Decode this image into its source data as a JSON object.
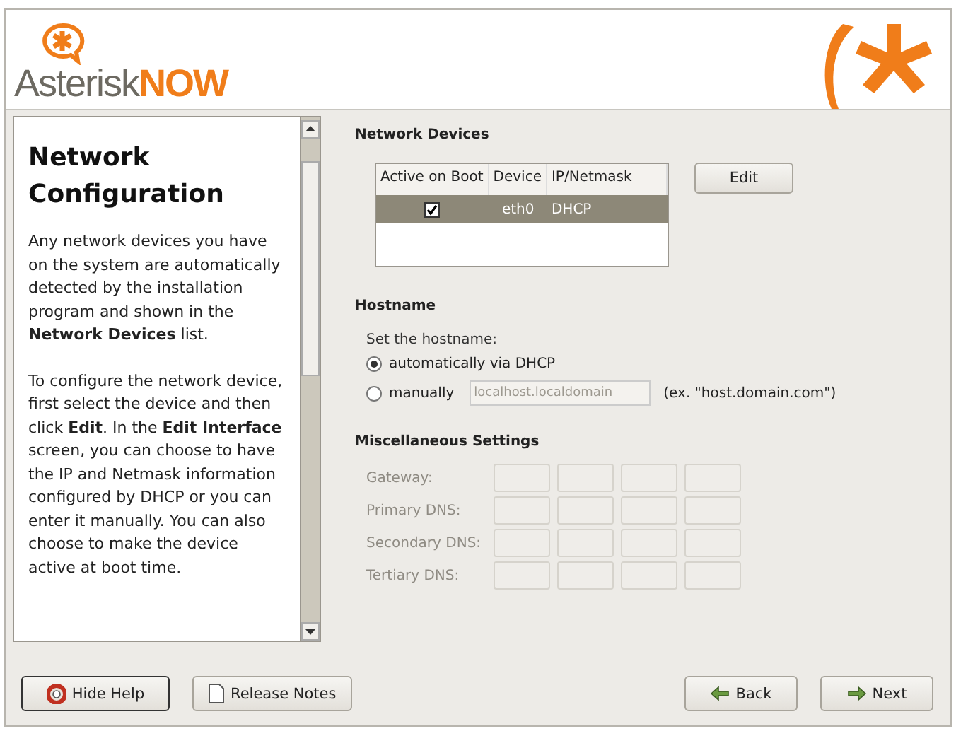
{
  "logo": {
    "word": "Asterisk",
    "accent": "NOW"
  },
  "help": {
    "title": "Network Configuration",
    "paragraphs": [
      "Any network devices you have on the system are automatically detected by the installation program and shown in the **Network Devices** list.",
      "To configure the network device, first select the device and then click **Edit**. In the **Edit Interface** screen, you can choose to have the IP and Netmask information configured by DHCP or you can enter it manually. You can also choose to make the device active at boot time."
    ]
  },
  "network_devices": {
    "heading": "Network Devices",
    "columns": [
      "Active on Boot",
      "Device",
      "IP/Netmask"
    ],
    "rows": [
      {
        "active": true,
        "device": "eth0",
        "ip": "DHCP",
        "selected": true
      }
    ],
    "edit_button": "Edit"
  },
  "hostname": {
    "heading": "Hostname",
    "prompt": "Set the hostname:",
    "options": [
      {
        "label": "automatically via DHCP",
        "selected": true
      },
      {
        "label": "manually",
        "selected": false,
        "value": "localhost.localdomain",
        "example": "(ex. \"host.domain.com\")"
      }
    ]
  },
  "misc": {
    "heading": "Miscellaneous Settings",
    "disabled": true,
    "fields": [
      {
        "label": "Gateway:"
      },
      {
        "label": "Primary DNS:"
      },
      {
        "label": "Secondary DNS:"
      },
      {
        "label": "Tertiary DNS:"
      }
    ]
  },
  "buttons": {
    "left": [
      {
        "label": "Hide Help",
        "kind": "help",
        "pressed": true
      },
      {
        "label": "Release Notes",
        "kind": "notes",
        "pressed": false
      }
    ],
    "right": [
      {
        "label": "Back",
        "kind": "back",
        "pressed": false
      },
      {
        "label": "Next",
        "kind": "next",
        "pressed": false
      }
    ]
  }
}
